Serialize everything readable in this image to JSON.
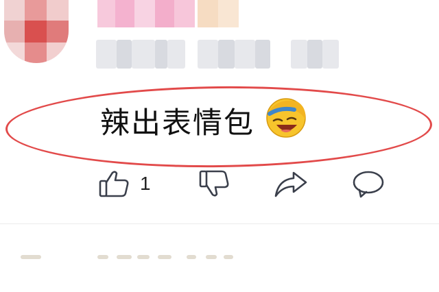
{
  "comment": {
    "text": "辣出表情包",
    "emoji": "laughing-tears-emoji"
  },
  "actions": {
    "like_count": "1",
    "icons": [
      "thumbs-up-icon",
      "thumbs-down-icon",
      "share-icon",
      "comment-icon"
    ]
  },
  "colors": {
    "highlight": "#e24a4a",
    "icon": "#3a3f4b"
  }
}
